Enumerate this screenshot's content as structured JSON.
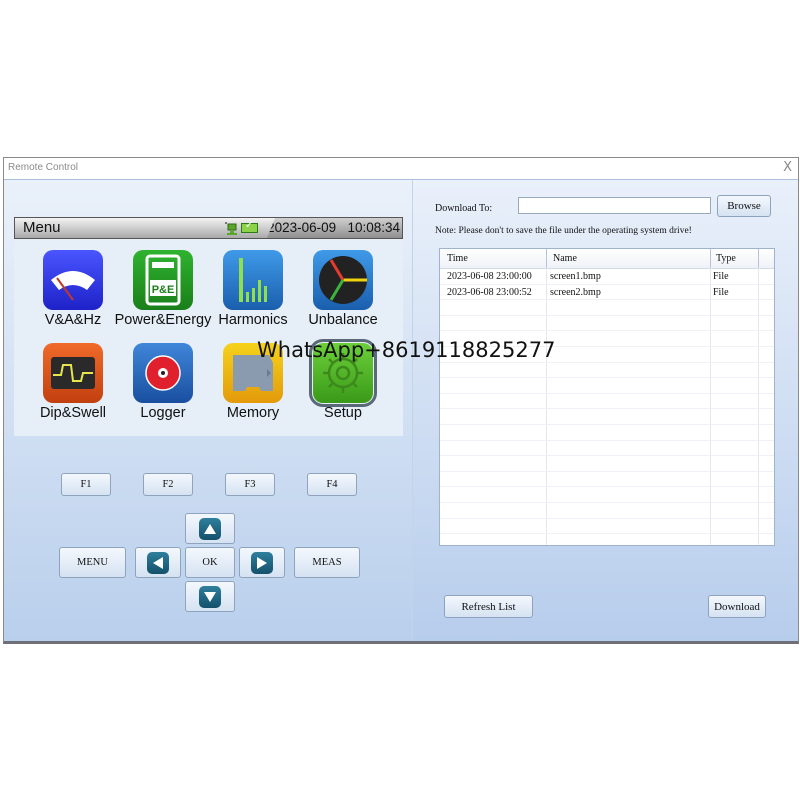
{
  "window": {
    "title": "Remote Control",
    "close_glyph": "X"
  },
  "device": {
    "menubar": {
      "title": "Menu",
      "date": "2023-06-09",
      "time": "10:08:34"
    },
    "apps": [
      {
        "label": "V&A&Hz",
        "icon": "meter-gauge-icon"
      },
      {
        "label": "Power&Energy",
        "icon": "power-energy-meter-icon",
        "badge": "P&E"
      },
      {
        "label": "Harmonics",
        "icon": "harmonics-bars-icon"
      },
      {
        "label": "Unbalance",
        "icon": "phasor-diagram-icon"
      },
      {
        "label": "Dip&Swell",
        "icon": "waveform-icon"
      },
      {
        "label": "Logger",
        "icon": "record-disc-icon"
      },
      {
        "label": "Memory",
        "icon": "sd-card-icon"
      },
      {
        "label": "Setup",
        "icon": "gear-icon",
        "selected": true
      }
    ]
  },
  "keypad": {
    "function_keys": [
      "F1",
      "F2",
      "F3",
      "F4"
    ],
    "menu": "MENU",
    "ok": "OK",
    "meas": "MEAS"
  },
  "download": {
    "label": "Download To:",
    "path_value": "",
    "browse": "Browse",
    "note": "Note: Please don't to save the file under the operating system drive!",
    "columns": [
      "Time",
      "Name",
      "Type"
    ],
    "rows": [
      {
        "time": "2023-06-08 23:00:00",
        "name": "screen1.bmp",
        "type": "File"
      },
      {
        "time": "2023-06-08 23:00:52",
        "name": "screen2.bmp",
        "type": "File"
      }
    ],
    "refresh": "Refresh List",
    "download": "Download"
  },
  "watermark": "WhatsApp+8619118825277"
}
